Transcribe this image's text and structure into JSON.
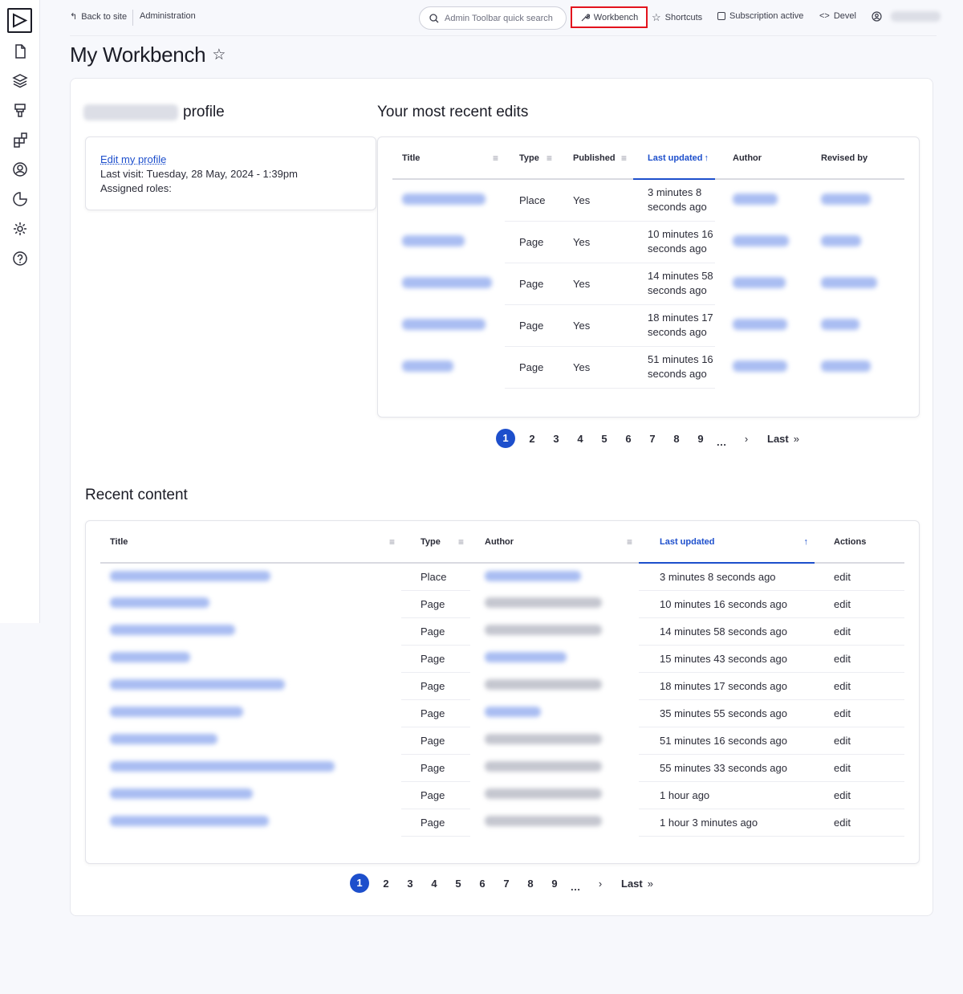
{
  "toolbar": {
    "back_to_site": "Back to site",
    "administration": "Administration",
    "search_placeholder": "Admin Toolbar quick search",
    "workbench": "Workbench",
    "shortcuts": "Shortcuts",
    "subscription": "Subscription active",
    "devel": "Devel"
  },
  "page": {
    "title": "My Workbench"
  },
  "profile": {
    "heading_suffix": "profile",
    "edit_link": "Edit my profile",
    "last_visit": "Last visit: Tuesday, 28 May, 2024 - 1:39pm",
    "assigned_roles": "Assigned roles:"
  },
  "recent_edits": {
    "heading": "Your most recent edits",
    "columns": [
      "Title",
      "Type",
      "Published",
      "Last updated",
      "Author",
      "Revised by"
    ],
    "rows": [
      {
        "type": "Place",
        "published": "Yes",
        "updated_1": "3 minutes 8",
        "updated_2": "seconds ago"
      },
      {
        "type": "Page",
        "published": "Yes",
        "updated_1": "10 minutes 16",
        "updated_2": "seconds ago"
      },
      {
        "type": "Page",
        "published": "Yes",
        "updated_1": "14 minutes 58",
        "updated_2": "seconds ago"
      },
      {
        "type": "Page",
        "published": "Yes",
        "updated_1": "18 minutes 17",
        "updated_2": "seconds ago"
      },
      {
        "type": "Page",
        "published": "Yes",
        "updated_1": "51 minutes 16",
        "updated_2": "seconds ago"
      }
    ],
    "pager": {
      "pages": [
        "1",
        "2",
        "3",
        "4",
        "5",
        "6",
        "7",
        "8",
        "9"
      ],
      "ellipsis": "…",
      "next": "›",
      "last": "Last",
      "last_icon": "»"
    }
  },
  "recent_content": {
    "heading": "Recent content",
    "columns": [
      "Title",
      "Type",
      "Author",
      "Last updated",
      "Actions"
    ],
    "rows": [
      {
        "type": "Place",
        "updated": "3 minutes 8 seconds ago",
        "action": "edit"
      },
      {
        "type": "Page",
        "updated": "10 minutes 16 seconds ago",
        "action": "edit"
      },
      {
        "type": "Page",
        "updated": "14 minutes 58 seconds ago",
        "action": "edit"
      },
      {
        "type": "Page",
        "updated": "15 minutes 43 seconds ago",
        "action": "edit"
      },
      {
        "type": "Page",
        "updated": "18 minutes 17 seconds ago",
        "action": "edit"
      },
      {
        "type": "Page",
        "updated": "35 minutes 55 seconds ago",
        "action": "edit"
      },
      {
        "type": "Page",
        "updated": "51 minutes 16 seconds ago",
        "action": "edit"
      },
      {
        "type": "Page",
        "updated": "55 minutes 33 seconds ago",
        "action": "edit"
      },
      {
        "type": "Page",
        "updated": "1 hour ago",
        "action": "edit"
      },
      {
        "type": "Page",
        "updated": "1 hour 3 minutes ago",
        "action": "edit"
      }
    ],
    "pager": {
      "pages": [
        "1",
        "2",
        "3",
        "4",
        "5",
        "6",
        "7",
        "8",
        "9"
      ],
      "ellipsis": "…",
      "next": "›",
      "last": "Last",
      "last_icon": "»"
    }
  },
  "colors": {
    "accent": "#1d4fcc",
    "highlight": "#e3131d"
  },
  "icons": {
    "sidebar": [
      "file-icon",
      "layers-icon",
      "brush-icon",
      "blocks-icon",
      "user-circle-icon",
      "chart-pie-icon",
      "gear-icon",
      "help-icon"
    ]
  }
}
